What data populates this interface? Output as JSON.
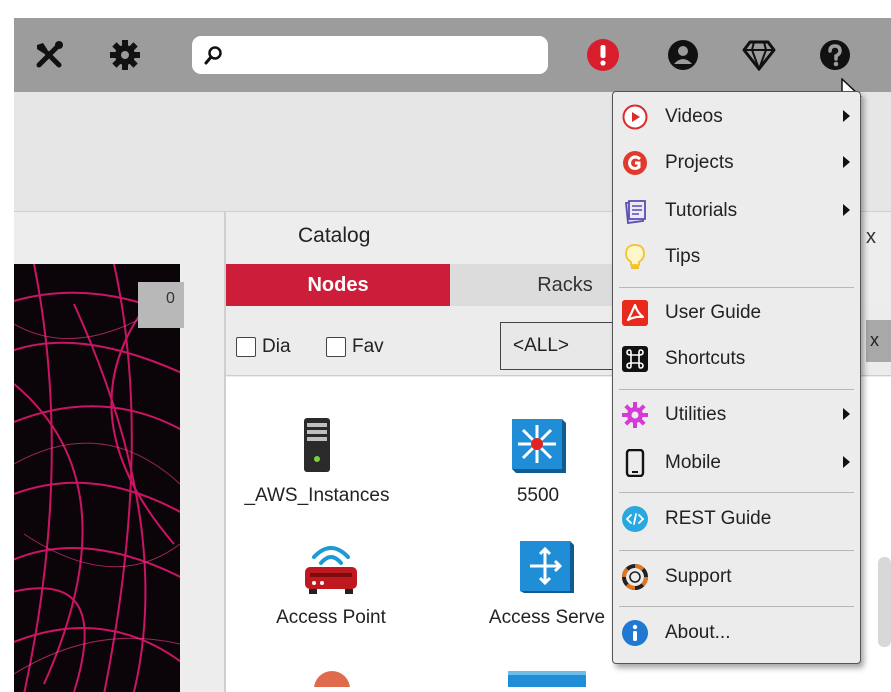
{
  "toolbar": {
    "icons": [
      "tools-icon",
      "gear-icon",
      "alert-icon",
      "user-icon",
      "diamond-icon",
      "help-icon"
    ],
    "search_placeholder": "",
    "colors": {
      "bar": "#9c9c9c",
      "alert": "#d81e2d"
    }
  },
  "canvas": {
    "badge": "0"
  },
  "catalog": {
    "title": "Catalog",
    "close": "x",
    "tabs": [
      "Nodes",
      "Racks"
    ],
    "filters": {
      "dia": "Dia",
      "fav": "Fav",
      "select": "<ALL>",
      "clear": "x"
    },
    "nodes": [
      "_AWS_Instances",
      "5500",
      "Access Point",
      "Access Serve"
    ]
  },
  "help_menu": {
    "items": [
      {
        "label": "Videos",
        "icon": "play-icon",
        "submenu": true
      },
      {
        "label": "Projects",
        "icon": "projects-icon",
        "submenu": true
      },
      {
        "label": "Tutorials",
        "icon": "tutorials-icon",
        "submenu": true
      },
      {
        "label": "Tips",
        "icon": "lightbulb-icon",
        "submenu": false
      },
      {
        "label": "User Guide",
        "icon": "pdf-icon",
        "submenu": false
      },
      {
        "label": "Shortcuts",
        "icon": "command-key-icon",
        "submenu": false
      },
      {
        "label": "Utilities",
        "icon": "utilities-icon",
        "submenu": true
      },
      {
        "label": "Mobile",
        "icon": "mobile-icon",
        "submenu": true
      },
      {
        "label": "REST Guide",
        "icon": "code-icon",
        "submenu": false
      },
      {
        "label": "Support",
        "icon": "lifebuoy-icon",
        "submenu": false
      },
      {
        "label": "About...",
        "icon": "info-icon",
        "submenu": false
      }
    ]
  }
}
